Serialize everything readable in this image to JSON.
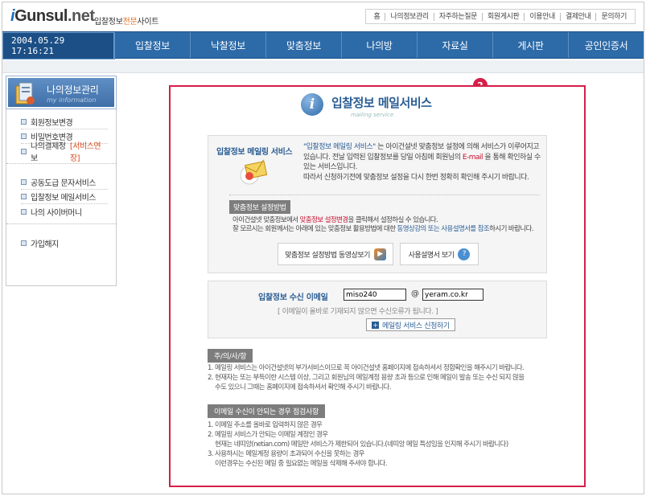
{
  "header": {
    "logo_i": "i",
    "logo_main": "Gunsul",
    "logo_net": ".net",
    "tagline_pre": "입찰정보",
    "tagline_hl": "전문",
    "tagline_post": "사이트",
    "toplinks": [
      "홈",
      "나의정보관리",
      "자주하는질문",
      "회원게시판",
      "이용안내",
      "결제안내",
      "문의하기"
    ]
  },
  "nav": {
    "datetime": "2004.05.29 17:16:21",
    "items": [
      "입찰정보",
      "낙찰정보",
      "맞춤정보",
      "나의방",
      "자료실",
      "게시판",
      "공인인증서"
    ]
  },
  "sidebar": {
    "title": "나의정보관리",
    "subtitle": "my information",
    "group1": [
      {
        "label": "회원정보변경",
        "extra": ""
      },
      {
        "label": "비밀번호변경",
        "extra": ""
      },
      {
        "label": "나의결제정보 ",
        "extra": "[서비스연장]"
      }
    ],
    "group2": [
      {
        "label": "공동도급 문자서비스"
      },
      {
        "label": "입찰정보 메일서비스"
      },
      {
        "label": "나의 사이버머니"
      }
    ],
    "group3": [
      {
        "label": "가입해지"
      }
    ]
  },
  "main": {
    "badge": "2",
    "title": "입찰정보 메일서비스",
    "title_sub": "mailing service",
    "service": {
      "heading": "입찰정보 메일링 서비스",
      "desc_1a": "\"입찰정보 메일링 서비스\"",
      "desc_1b": " 는 아이건설넷 맞춤정보 설정에 의해 서비스가 이루어지고 있습니다. 전날 입력된 입찰정보를 당일 아침에 회원님의 ",
      "desc_1c": "E-mail",
      "desc_1d": " 을 통해 확인하실 수 있는 서비스입니다.",
      "desc_2": "따라서 신청하기전에 맞춤정보 설정을 다시 한번 정확히 확인해 주시기 바랍니다.",
      "setting_tag": "맞춤정보 설정방법",
      "setting_1a": "아이건설넷 맞춤정보에서 ",
      "setting_1b": "맞춤정보 설정변경",
      "setting_1c": "을 클릭해서 설정하실 수 있습니다.",
      "setting_2a": "잘 모르시는 회원께서는 아래에 있는 맞춤정보 활용방법에 대한 ",
      "setting_2b": "동영상강의 또는 사용설명서를 참조",
      "setting_2c": "하시기 바랍니다.",
      "btn_video": "맞춤정보 설정방법 동영상보기",
      "btn_manual": "사용설명서 보기"
    },
    "email": {
      "label": "입찰정보 수신 이메일",
      "user": "miso240",
      "at": "@",
      "domain": "yeram.co.kr",
      "note": "[ 이메일이 올바로 기재되지 않으면 수신오류가 됩니다. ]",
      "apply_btn": "메일링 서비스 신청하기"
    },
    "caution": {
      "tag": "주/의/사/항",
      "lines": [
        "1. 메일링 서비스는 아이건설넷의 부가서비스이므로 꼭 아이건설넷 홈페이지에 접속하셔서 정합확인을 해주시기 바랍니다.",
        "2. 현재자는 또는 부득이한 시스템 이상, 그리고 회원님의 메일계정 용량 초과 등으로 인해 메일이 발송 또는 수신 되지 않을",
        "    수도 있으니 그때는 홈페이지에 접속하셔서 확인해 주시기 바랍니다."
      ]
    },
    "fail": {
      "tag": "이메일 수신이 안되는 경우 점검사항",
      "lines": [
        "1. 이메일 주소를 올바로 입력하지 않은 경우",
        "2. 메일링 서비스가 안되는 이메일 계정인 경우",
        "    현재는 네띠앙(netian.com) 메일만 서비스가 제한되어 있습니다.(네띠앙 메일 특성임을 인지해 주시기 바랍니다)",
        "3. 사용하시는 메일계정 용량이 초과되어 수신을 못하는 경우",
        "    이런경우는 수신된 메일 중 필요없는 메일을 삭제해 주셔야 합니다."
      ]
    }
  }
}
